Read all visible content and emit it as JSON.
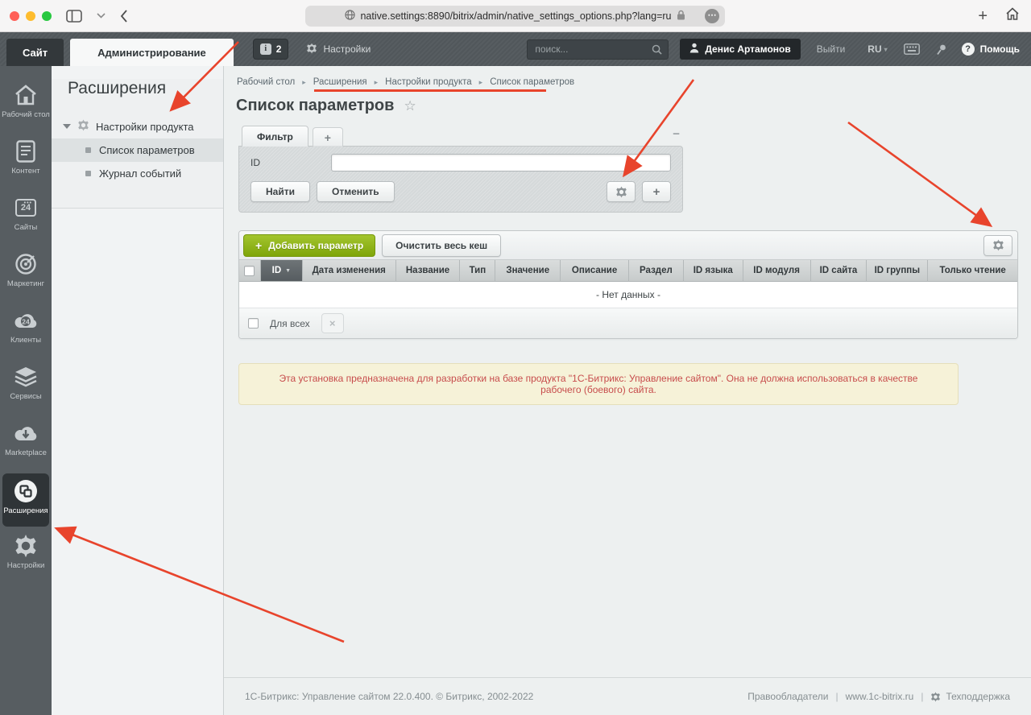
{
  "browser": {
    "url": "native.settings:8890/bitrix/admin/native_settings_options.php?lang=ru"
  },
  "topbar": {
    "tab_site": "Сайт",
    "tab_admin": "Администрирование",
    "notifications_count": "2",
    "settings_label": "Настройки",
    "search_placeholder": "поиск...",
    "user_name": "Денис Артамонов",
    "logout_label": "Выйти",
    "lang_label": "RU",
    "help_label": "Помощь"
  },
  "sidebar": {
    "items": [
      {
        "label": "Рабочий стол"
      },
      {
        "label": "Контент"
      },
      {
        "label": "Сайты"
      },
      {
        "label": "Маркетинг"
      },
      {
        "label": "Клиенты"
      },
      {
        "label": "Сервисы"
      },
      {
        "label": "Marketplace"
      },
      {
        "label": "Расширения"
      },
      {
        "label": "Настройки"
      }
    ],
    "sites_badge": "24",
    "clients_badge": "24"
  },
  "tree": {
    "heading": "Расширения",
    "group_label": "Настройки продукта",
    "items": [
      {
        "label": "Список параметров"
      },
      {
        "label": "Журнал событий"
      }
    ]
  },
  "breadcrumbs": [
    "Рабочий стол",
    "Расширения",
    "Настройки продукта",
    "Список параметров"
  ],
  "page": {
    "title": "Список параметров"
  },
  "filter": {
    "tab_label": "Фильтр",
    "id_label": "ID",
    "id_value": "",
    "find_label": "Найти",
    "cancel_label": "Отменить"
  },
  "grid": {
    "add_button": "Добавить параметр",
    "clear_cache_button": "Очистить весь кеш",
    "columns": [
      "ID",
      "Дата изменения",
      "Название",
      "Тип",
      "Значение",
      "Описание",
      "Раздел",
      "ID языка",
      "ID модуля",
      "ID сайта",
      "ID группы",
      "Только чтение"
    ],
    "empty_text": "- Нет данных -",
    "footer_label": "Для всех"
  },
  "warning": {
    "text": "Эта установка предназначена для разработки на базе продукта \"1С-Битрикс: Управление сайтом\". Она не должна использоваться в качестве рабочего (боевого) сайта."
  },
  "footer": {
    "copyright": "1С-Битрикс: Управление сайтом 22.0.400. © Битрикс, 2002-2022",
    "rights_label": "Правообладатели",
    "site_label": "www.1c-bitrix.ru",
    "support_label": "Техподдержка"
  },
  "glyphs": {
    "plus": "+",
    "minus": "−",
    "close": "×",
    "question": "?",
    "caret_down": "▾",
    "crumb_sep": "▸",
    "pipe": "|",
    "sort_caret": "▼",
    "star": "☆",
    "info": "i",
    "ellipsis": "⋯"
  },
  "colors": {
    "accent_green": "#8db516",
    "arrow_red": "#e8442c",
    "warning_text": "#c74c4c"
  }
}
